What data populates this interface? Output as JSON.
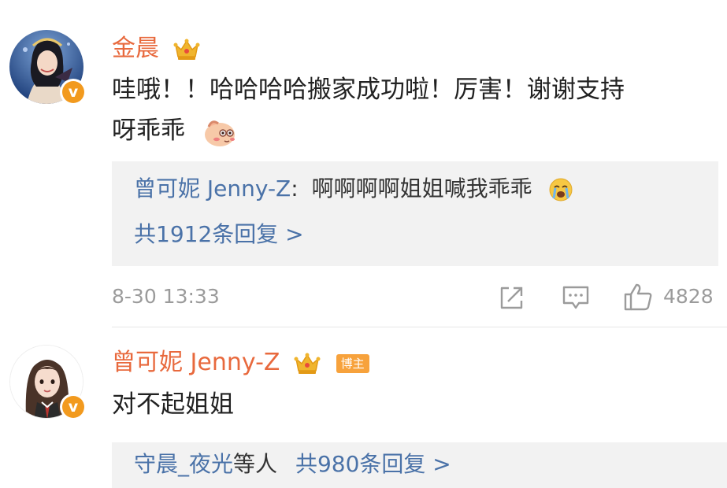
{
  "comments": [
    {
      "username": "金晨",
      "text_line1": "哇哦！！哈哈哈哈搬家成功啦！厉害！谢谢支持",
      "text_line2": "呀乖乖",
      "reply_preview": {
        "author": "曾可妮 Jenny-Z",
        "separator": ":",
        "text": "啊啊啊啊姐姐喊我乖乖"
      },
      "reply_count_text": "共1912条回复 >",
      "timestamp": "8-30 13:33",
      "like_count": "4828"
    },
    {
      "username": "曾可妮 Jenny-Z",
      "badge": "博主",
      "text": "对不起姐姐",
      "reply_summary": {
        "names": "守晨_夜光",
        "suffix": "等人",
        "count_text": "共980条回复 >"
      }
    }
  ],
  "icons": {
    "verified": "v-verified-icon",
    "crown": "crown-member-icon",
    "emoji_shy": "shy-pig-emoji",
    "emoji_crying": "crying-face-emoji",
    "share": "share-icon",
    "comment": "comment-icon",
    "like": "thumbs-up-icon"
  },
  "verified_letter": "v",
  "colors": {
    "username": "#e8693d",
    "link": "#4a72a8",
    "reply_bg": "#f2f2f2",
    "meta": "#9b9b9b",
    "verified": "#f29a1e"
  }
}
